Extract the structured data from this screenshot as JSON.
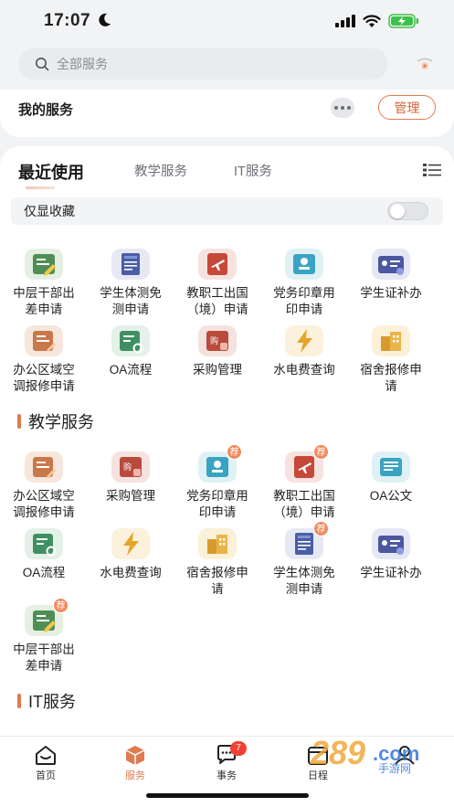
{
  "status_bar": {
    "time": "17:07",
    "moon_icon": "moon-icon",
    "battery_color": "#3ec14a"
  },
  "search": {
    "placeholder": "全部服务"
  },
  "my_services": {
    "title": "我的服务",
    "manage_label": "管理"
  },
  "tabs": [
    {
      "label": "最近使用",
      "active": true
    },
    {
      "label": "教学服务",
      "active": false
    },
    {
      "label": "IT服务",
      "active": false
    }
  ],
  "favorites_filter": {
    "label": "仅显收藏",
    "on": false
  },
  "recent": [
    {
      "lines": [
        "中层干部出",
        "差申请"
      ],
      "icon": "business-trip-icon",
      "badge": ""
    },
    {
      "lines": [
        "学生体测免",
        "测申请"
      ],
      "icon": "fitness-test-icon",
      "badge": ""
    },
    {
      "lines": [
        "教职工出国",
        "（境）申请"
      ],
      "icon": "going-abroad-icon",
      "badge": ""
    },
    {
      "lines": [
        "党务印章用",
        "印申请"
      ],
      "icon": "seal-icon",
      "badge": ""
    },
    {
      "lines": [
        "学生证补办",
        ""
      ],
      "icon": "student-card-icon",
      "badge": ""
    },
    {
      "lines": [
        "办公区域空",
        "调报修申请"
      ],
      "icon": "aircon-repair-icon",
      "badge": ""
    },
    {
      "lines": [
        "OA流程",
        ""
      ],
      "icon": "oa-flow-icon",
      "badge": ""
    },
    {
      "lines": [
        "采购管理",
        ""
      ],
      "icon": "purchase-icon",
      "badge": ""
    },
    {
      "lines": [
        "水电费查询",
        ""
      ],
      "icon": "utility-bill-icon",
      "badge": ""
    },
    {
      "lines": [
        "宿舍报修申",
        "请"
      ],
      "icon": "dorm-repair-icon",
      "badge": ""
    }
  ],
  "teaching_section": {
    "title": "教学服务"
  },
  "teaching": [
    {
      "lines": [
        "办公区域空",
        "调报修申请"
      ],
      "icon": "aircon-repair-icon",
      "badge": ""
    },
    {
      "lines": [
        "采购管理",
        ""
      ],
      "icon": "purchase-icon",
      "badge": ""
    },
    {
      "lines": [
        "党务印章用",
        "印申请"
      ],
      "icon": "seal-icon",
      "badge": "荐"
    },
    {
      "lines": [
        "教职工出国",
        "（境）申请"
      ],
      "icon": "going-abroad-icon",
      "badge": "荐"
    },
    {
      "lines": [
        "OA公文",
        ""
      ],
      "icon": "oa-document-icon",
      "badge": ""
    },
    {
      "lines": [
        "OA流程",
        ""
      ],
      "icon": "oa-flow-icon",
      "badge": ""
    },
    {
      "lines": [
        "水电费查询",
        ""
      ],
      "icon": "utility-bill-icon",
      "badge": ""
    },
    {
      "lines": [
        "宿舍报修申",
        "请"
      ],
      "icon": "dorm-repair-icon",
      "badge": ""
    },
    {
      "lines": [
        "学生体测免",
        "测申请"
      ],
      "icon": "fitness-test-icon",
      "badge": "荐"
    },
    {
      "lines": [
        "学生证补办",
        ""
      ],
      "icon": "student-card-icon",
      "badge": ""
    },
    {
      "lines": [
        "中层干部出",
        "差申请"
      ],
      "icon": "business-trip-icon",
      "badge": "荐"
    }
  ],
  "it_section": {
    "title": "IT服务"
  },
  "tabbar": [
    {
      "label": "首页",
      "active": false,
      "badge": ""
    },
    {
      "label": "服务",
      "active": true,
      "badge": ""
    },
    {
      "label": "事务",
      "active": false,
      "badge": "7"
    },
    {
      "label": "日程",
      "active": false,
      "badge": ""
    }
  ],
  "watermark": {
    "text": "289.com",
    "sub": "手游网"
  },
  "colors": {
    "accent": "#e07a4f",
    "badge_red": "#f04135"
  }
}
